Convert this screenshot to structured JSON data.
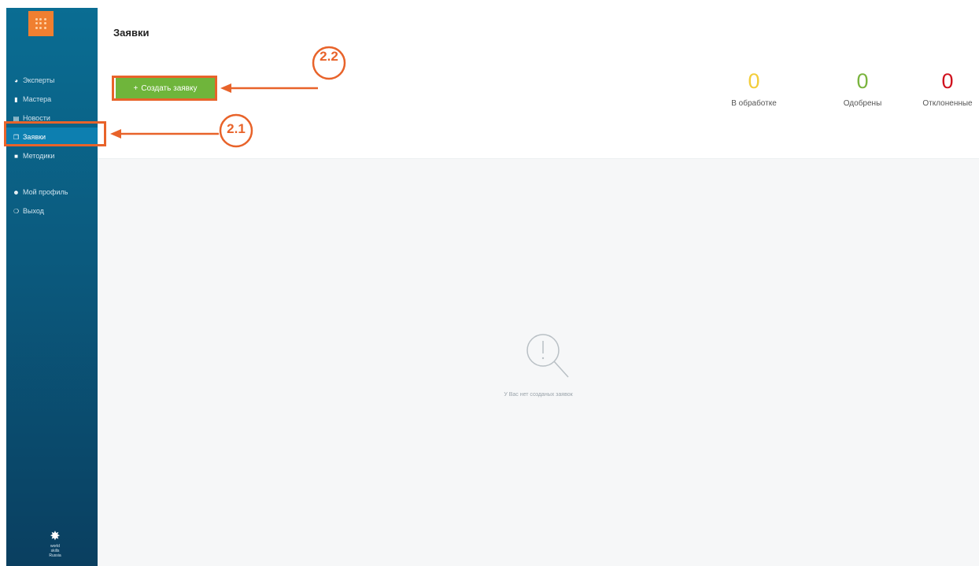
{
  "sidebar": {
    "items": [
      {
        "label": "Эксперты",
        "icon": "globe-icon"
      },
      {
        "label": "Мастера",
        "icon": "chart-icon"
      },
      {
        "label": "Новости",
        "icon": "news-icon"
      },
      {
        "label": "Заявки",
        "icon": "apps-icon",
        "active": true
      },
      {
        "label": "Методики",
        "icon": "book-icon"
      }
    ],
    "account_items": [
      {
        "label": "Мой профиль",
        "icon": "user-icon"
      },
      {
        "label": "Выход",
        "icon": "power-icon"
      }
    ],
    "footer_logo": {
      "line1": "world",
      "line2": "skills",
      "line3": "Russia"
    }
  },
  "header": {
    "title": "Заявки",
    "create_button": "Создать заявку",
    "stats": [
      {
        "value": "0",
        "label": "В обработке",
        "color": "#f3cd3a"
      },
      {
        "value": "0",
        "label": "Одобрены",
        "color": "#7ab43e"
      },
      {
        "value": "0",
        "label": "Отклоненные",
        "color": "#d0121e"
      }
    ]
  },
  "content": {
    "empty_text": "У Вас нет созданых заявок"
  },
  "annotations": {
    "label_1": "2.1",
    "label_2": "2.2",
    "color": "#e8632a"
  },
  "colors": {
    "sidebar": "#0a5a7e",
    "accent": "#f07f30",
    "button": "#6fb53b"
  }
}
